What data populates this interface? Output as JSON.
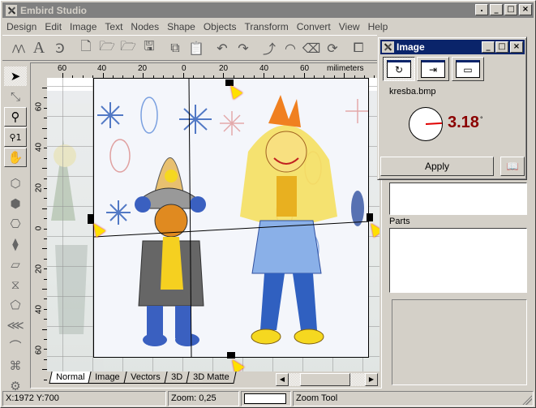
{
  "window": {
    "title": "Embird Studio",
    "controls": [
      ".",
      "_",
      "□",
      "×"
    ]
  },
  "menu": [
    "Design",
    "Edit",
    "Image",
    "Text",
    "Nodes",
    "Shape",
    "Objects",
    "Transform",
    "Convert",
    "View",
    "Help"
  ],
  "toolbar": {
    "tools": [
      {
        "name": "stitch-icon",
        "glyph": "⋀⋀"
      },
      {
        "name": "text-icon",
        "glyph": "A"
      },
      {
        "name": "text-edit-icon",
        "glyph": "Ꜿ"
      },
      {
        "name": "new-file-icon",
        "glyph": "🗋"
      },
      {
        "name": "open-icon",
        "glyph": "🗁"
      },
      {
        "name": "import-icon",
        "glyph": "🗁"
      },
      {
        "name": "save-icon",
        "glyph": "🖫"
      },
      {
        "name": "copy-icon",
        "glyph": "⧉"
      },
      {
        "name": "paste-icon",
        "glyph": "📋"
      },
      {
        "name": "undo-icon",
        "glyph": "↶"
      },
      {
        "name": "redo-icon",
        "glyph": "↷"
      },
      {
        "name": "curve-icon",
        "glyph": "⤴"
      },
      {
        "name": "gauge-icon",
        "glyph": "◠"
      },
      {
        "name": "eraser-icon",
        "glyph": "⌫"
      },
      {
        "name": "rotate-frame-icon",
        "glyph": "⟳"
      },
      {
        "name": "frame-icon",
        "glyph": "⧠"
      }
    ]
  },
  "side_tools": [
    {
      "name": "select-arrow-icon",
      "glyph": "➤",
      "style": "pressed"
    },
    {
      "name": "node-edit-icon",
      "glyph": "⤡",
      "style": "plain"
    },
    {
      "name": "zoom-icon",
      "glyph": "⚲",
      "style": "boxed"
    },
    {
      "name": "zoom-1-icon",
      "glyph": "⚲1",
      "style": "boxed"
    },
    {
      "name": "hand-pan-icon",
      "glyph": "✋",
      "style": "boxed"
    },
    {
      "name": "shape-outline-icon",
      "glyph": "⬡",
      "style": "plain"
    },
    {
      "name": "shape-fill-icon",
      "glyph": "⬢",
      "style": "plain"
    },
    {
      "name": "shape-hole-icon",
      "glyph": "⎔",
      "style": "plain"
    },
    {
      "name": "shape-pattern-icon",
      "glyph": "⧫",
      "style": "plain"
    },
    {
      "name": "shape-wave-icon",
      "glyph": "▱",
      "style": "plain"
    },
    {
      "name": "shape-twist-icon",
      "glyph": "⧖",
      "style": "plain"
    },
    {
      "name": "shape-polygon-icon",
      "glyph": "⬠",
      "style": "plain"
    },
    {
      "name": "zigzag-icon",
      "glyph": "⋘",
      "style": "plain"
    },
    {
      "name": "curve-tool-icon",
      "glyph": "⌒",
      "style": "plain"
    },
    {
      "name": "knot-icon",
      "glyph": "⌘",
      "style": "plain"
    },
    {
      "name": "gear-shape-icon",
      "glyph": "⚙",
      "style": "plain"
    }
  ],
  "ruler": {
    "unit": "milimeters",
    "h_labels": [
      "60",
      "40",
      "20",
      "0",
      "20",
      "40",
      "60"
    ],
    "v_labels": [
      "60",
      "40",
      "20",
      "0",
      "20",
      "40",
      "60"
    ]
  },
  "doc_tabs": [
    {
      "label": "Normal",
      "active": true
    },
    {
      "label": "Image",
      "active": false
    },
    {
      "label": "Vectors",
      "active": false
    },
    {
      "label": "3D",
      "active": false
    },
    {
      "label": "3D Matte",
      "active": false
    }
  ],
  "status": {
    "coords": "X:1972  Y:700",
    "zoom": "Zoom: 0,25",
    "tool": "Zoom Tool"
  },
  "image_dialog": {
    "title": "Image",
    "filename": "kresba.bmp",
    "rotation_angle": "3.18",
    "angle_unit": "°",
    "apply_label": "Apply",
    "mode_buttons": [
      {
        "name": "rotate-mode-icon",
        "glyph": "↻",
        "active": true
      },
      {
        "name": "move-mode-icon",
        "glyph": "⇥",
        "active": false
      },
      {
        "name": "frame-mode-icon",
        "glyph": "▭",
        "active": false
      }
    ],
    "help_icon": "book-icon"
  },
  "right_panel": {
    "parts_label": "Parts"
  },
  "colors": {
    "dialog_title": "#0a246a",
    "angle_text": "#8b0000",
    "needle": "#e00000"
  }
}
